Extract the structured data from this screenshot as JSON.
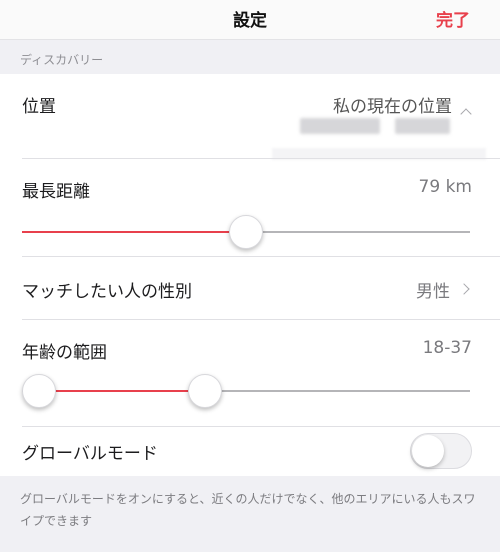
{
  "nav": {
    "title": "設定",
    "done_label": "完了"
  },
  "section": {
    "header": "ディスカバリー"
  },
  "location": {
    "label": "位置",
    "value": "私の現在の位置"
  },
  "distance": {
    "label": "最長距離",
    "value": "79 km",
    "slider_fraction": 0.5
  },
  "gender": {
    "label": "マッチしたい人の性別",
    "value": "男性"
  },
  "age": {
    "label": "年齢の範囲",
    "value": "18-37",
    "min_fraction": 0.0,
    "max_fraction": 0.4
  },
  "global_mode": {
    "label": "グローバルモード",
    "enabled": false
  },
  "footnote": "グローバルモードをオンにすると、近くの人だけでなく、他のエリアにいる人もスワイプできます",
  "colors": {
    "accent": "#e8404c",
    "track": "#b5b5b8",
    "background": "#f0f0f4"
  },
  "icons": {
    "chevron_right": "chevron-right-icon",
    "chevron_ne": "chevron-icon"
  }
}
